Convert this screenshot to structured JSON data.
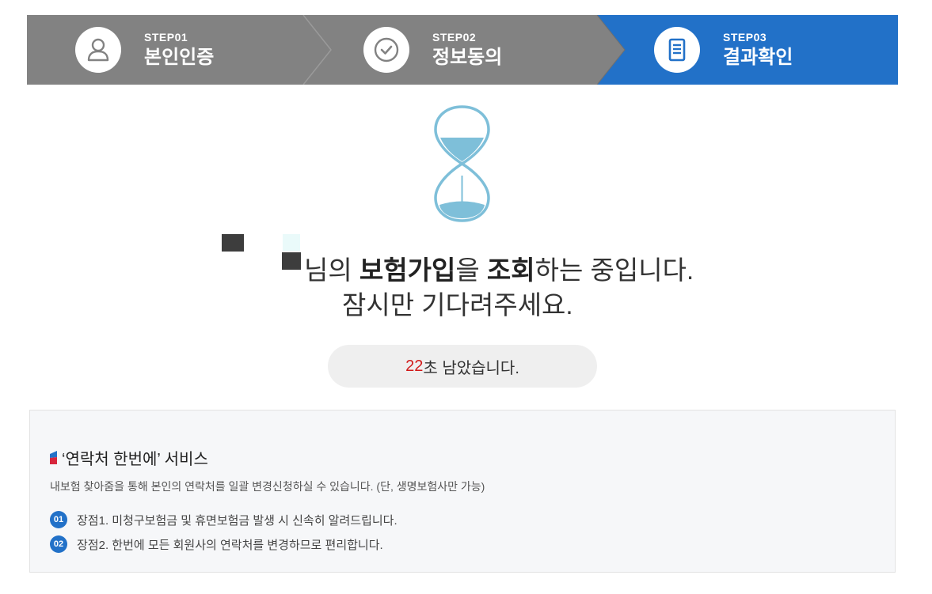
{
  "steps": [
    {
      "num": "STEP01",
      "name": "본인인증",
      "icon": "user-icon",
      "active": false
    },
    {
      "num": "STEP02",
      "name": "정보동의",
      "icon": "check-circle-icon",
      "active": false
    },
    {
      "num": "STEP03",
      "name": "결과확인",
      "icon": "document-icon",
      "active": true
    }
  ],
  "colors": {
    "step_inactive": "#828282",
    "step_active": "#2271c8",
    "hourglass": "#7ebfd9",
    "timer_seconds": "#d11a1a"
  },
  "status": {
    "line1_prefix": "님의 ",
    "line1_bold1": "보험가입",
    "line1_mid": "을 ",
    "line1_bold2": "조회",
    "line1_suffix": "하는 중입니다.",
    "line2": "잠시만 기다려주세요."
  },
  "timer": {
    "seconds": "22",
    "suffix": "초 남았습니다."
  },
  "service": {
    "title": "‘연락처 한번에’ 서비스",
    "description": "내보험 찾아줌을 통해 본인의 연락처를 일괄 변경신청하실 수 있습니다. (단, 생명보험사만 가능)",
    "merits": [
      {
        "badge": "01",
        "text": "장점1. 미청구보험금 및 휴면보험금 발생 시 신속히 알려드립니다."
      },
      {
        "badge": "02",
        "text": "장점2. 한번에 모든 회원사의 연락처를 변경하므로 편리합니다."
      }
    ]
  }
}
